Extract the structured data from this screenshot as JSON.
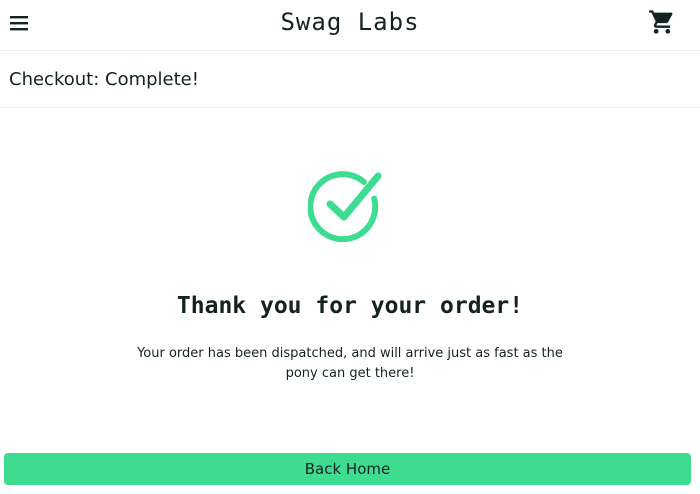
{
  "header": {
    "menu_icon": "hamburger-menu-icon",
    "app_title": "Swag Labs",
    "cart_icon": "shopping-cart-icon"
  },
  "secondary_header": {
    "title": "Checkout: Complete!"
  },
  "main": {
    "status_icon": "checkmark-circle-icon",
    "heading": "Thank you for your order!",
    "message": "Your order has been dispatched, and will arrive just as fast as the pony can get there!",
    "back_button_label": "Back Home"
  },
  "colors": {
    "accent": "#3ddc91",
    "text": "#132322",
    "divider": "#ededef"
  }
}
